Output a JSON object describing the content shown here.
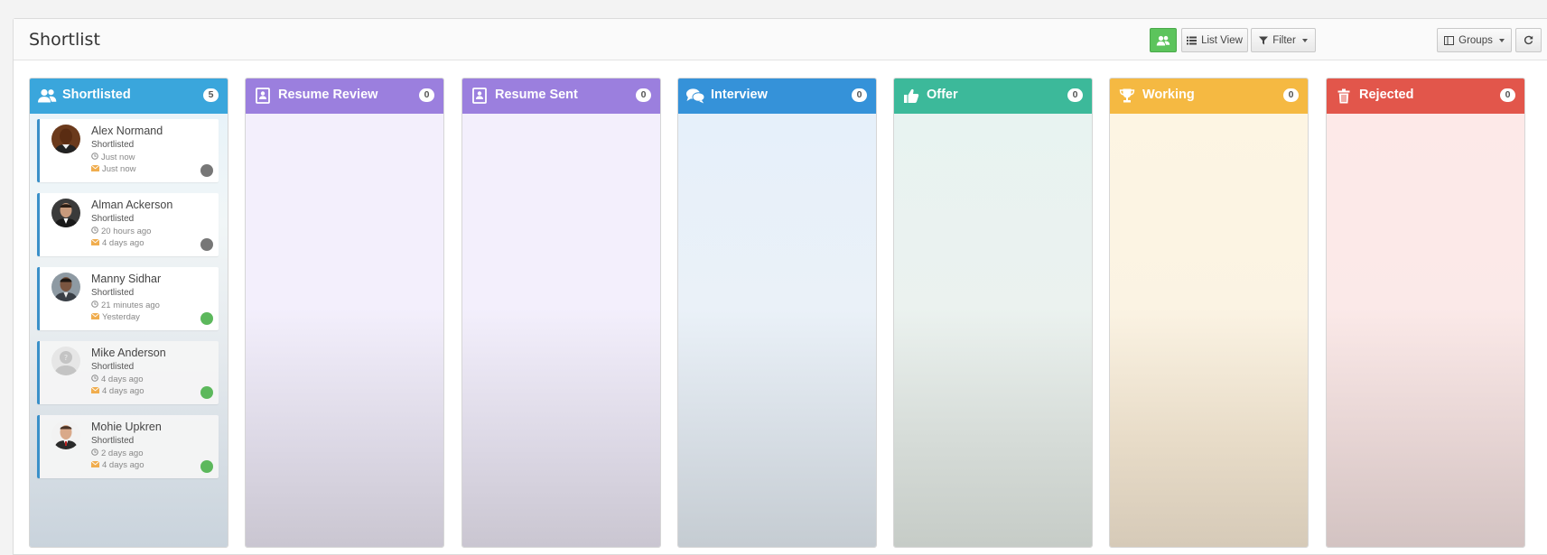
{
  "page": {
    "title": "Shortlist"
  },
  "toolbar": {
    "candidates_icon": "users-icon",
    "list_view_label": "List View",
    "filter_label": "Filter",
    "groups_label": "Groups",
    "refresh_icon": "refresh-icon"
  },
  "colors": {
    "shortlisted": "#3aa6dc",
    "resume_review": "#9b7fde",
    "resume_sent": "#9b7fde",
    "interview": "#3592d9",
    "offer": "#3cb99a",
    "working": "#f5b942",
    "rejected": "#e2564b",
    "online": "#5cb85c",
    "offline": "#777777"
  },
  "columns": [
    {
      "title": "Shortlisted",
      "count": "5",
      "icon": "users-icon"
    },
    {
      "title": "Resume Review",
      "count": "0",
      "icon": "resume-icon"
    },
    {
      "title": "Resume Sent",
      "count": "0",
      "icon": "resume-icon"
    },
    {
      "title": "Interview",
      "count": "0",
      "icon": "chat-icon"
    },
    {
      "title": "Offer",
      "count": "0",
      "icon": "thumbs-up-icon"
    },
    {
      "title": "Working",
      "count": "0",
      "icon": "trophy-icon"
    },
    {
      "title": "Rejected",
      "count": "0",
      "icon": "trash-icon"
    }
  ],
  "cards": [
    {
      "name": "Alex Normand",
      "status": "Shortlisted",
      "time": "Just now",
      "mail": "Just now",
      "presence": "offline"
    },
    {
      "name": "Alman Ackerson",
      "status": "Shortlisted",
      "time": "20 hours ago",
      "mail": "4 days ago",
      "presence": "offline"
    },
    {
      "name": "Manny Sidhar",
      "status": "Shortlisted",
      "time": "21 minutes ago",
      "mail": "Yesterday",
      "presence": "online"
    },
    {
      "name": "Mike Anderson",
      "status": "Shortlisted",
      "time": "4 days ago",
      "mail": "4 days ago",
      "presence": "online"
    },
    {
      "name": "Mohie Upkren",
      "status": "Shortlisted",
      "time": "2 days ago",
      "mail": "4 days ago",
      "presence": "online"
    }
  ]
}
